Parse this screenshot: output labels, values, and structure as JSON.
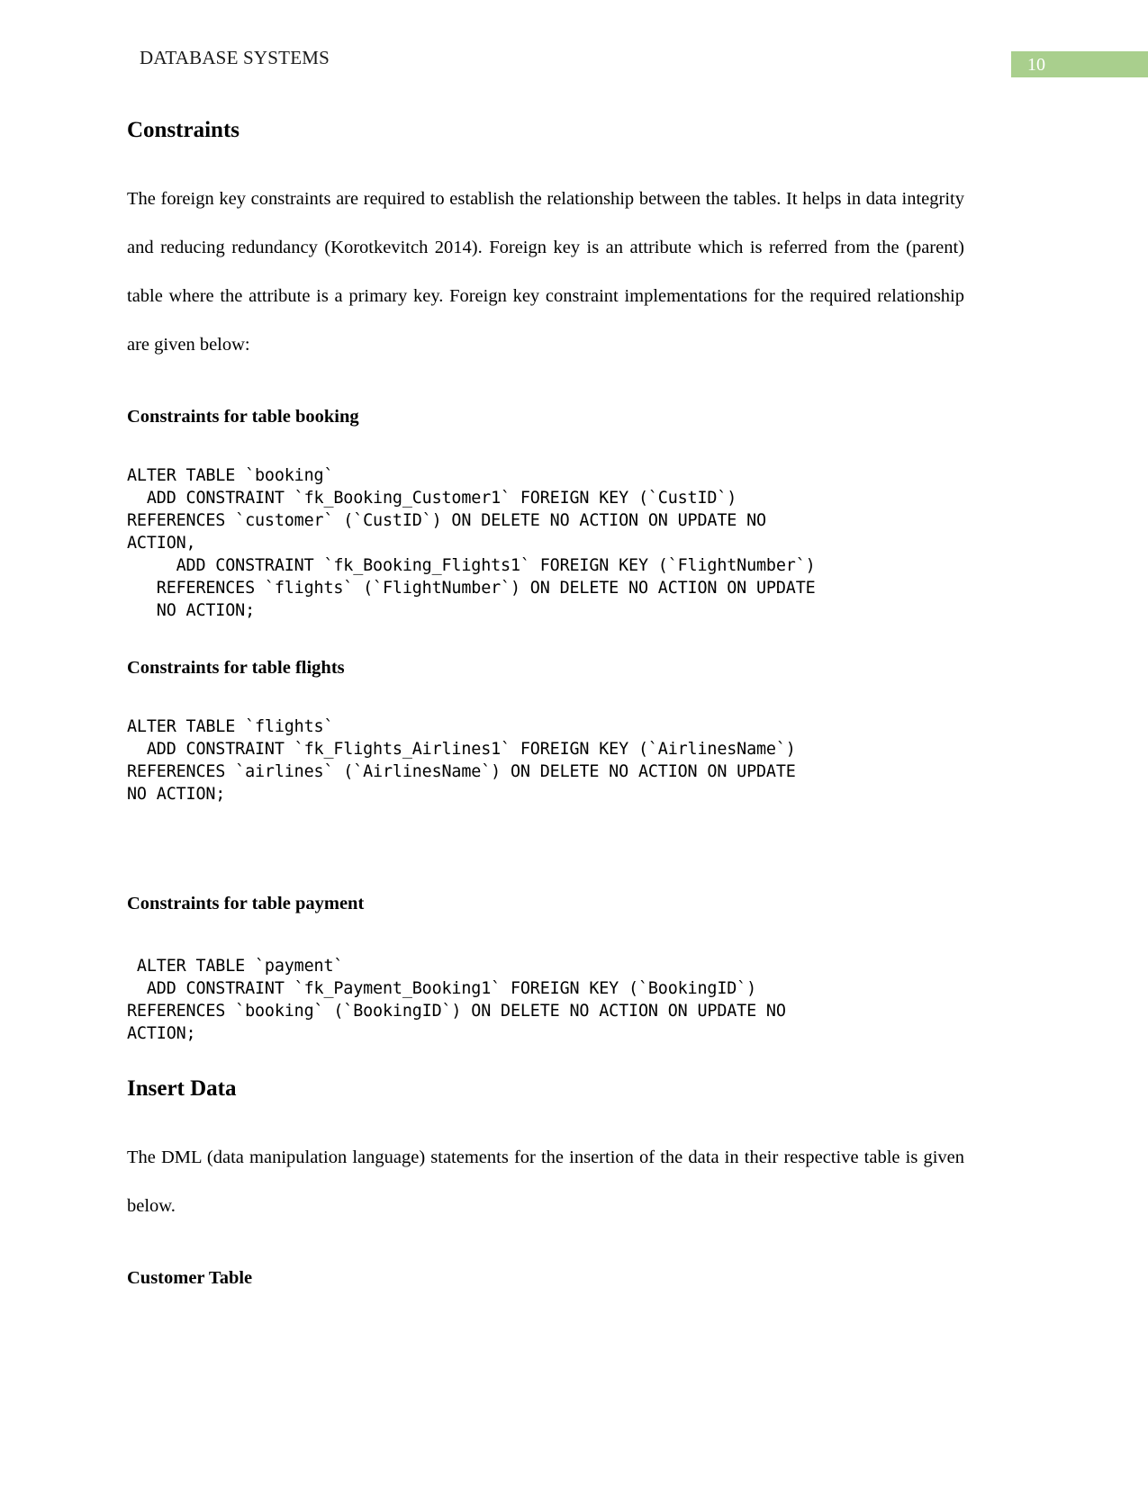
{
  "header": {
    "title": "DATABASE SYSTEMS",
    "page_number": "10",
    "page_number_box_color": "#a9cf8d"
  },
  "sections": {
    "constraints_heading": "Constraints",
    "intro_paragraph": "The foreign key constraints are required to establish the relationship between the tables. It helps in data integrity and reducing redundancy (Korotkevitch 2014). Foreign key is an attribute which is referred from the (parent) table where the attribute is a primary key. Foreign key constraint implementations for the required relationship are given below:",
    "booking_subheading": "Constraints for table booking",
    "booking_code": "ALTER TABLE `booking`\n  ADD CONSTRAINT `fk_Booking_Customer1` FOREIGN KEY (`CustID`)\nREFERENCES `customer` (`CustID`) ON DELETE NO ACTION ON UPDATE NO\nACTION,\n     ADD CONSTRAINT `fk_Booking_Flights1` FOREIGN KEY (`FlightNumber`)\n   REFERENCES `flights` (`FlightNumber`) ON DELETE NO ACTION ON UPDATE\n   NO ACTION;",
    "flights_subheading": "Constraints for table flights",
    "flights_code": "ALTER TABLE `flights`\n  ADD CONSTRAINT `fk_Flights_Airlines1` FOREIGN KEY (`AirlinesName`)\nREFERENCES `airlines` (`AirlinesName`) ON DELETE NO ACTION ON UPDATE\nNO ACTION;",
    "payment_subheading": "Constraints for table payment",
    "payment_code": " ALTER TABLE `payment`\n  ADD CONSTRAINT `fk_Payment_Booking1` FOREIGN KEY (`BookingID`)\nREFERENCES `booking` (`BookingID`) ON DELETE NO ACTION ON UPDATE NO\nACTION;",
    "insert_data_heading": "Insert Data",
    "insert_data_paragraph": "The DML (data manipulation language) statements for the insertion of the data in their respective table is given below.",
    "customer_table_subheading": "Customer Table"
  }
}
